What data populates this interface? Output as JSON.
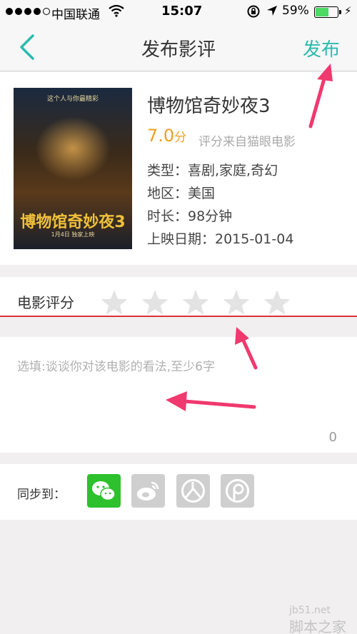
{
  "status": {
    "carrier": "中国联通",
    "time": "15:07",
    "battery_pct": "59%",
    "battery_level": 0.59,
    "signal_bars": 4
  },
  "nav": {
    "title": "发布影评",
    "publish_label": "发布"
  },
  "movie": {
    "title": "博物馆奇妙夜3",
    "rating_value": "7.0",
    "rating_unit": "分",
    "rating_source": "评分来自猫眼电影",
    "genre": "类型：喜剧,家庭,奇幻",
    "region": "地区：美国",
    "duration": "时长：98分钟",
    "release": "上映日期：2015-01-04",
    "poster": {
      "tagline": "这个人与你最精彩",
      "title": "博物馆奇妙夜3",
      "date": "1月4日 独家上映"
    }
  },
  "score": {
    "label": "电影评分",
    "stars": 5,
    "selected": 0
  },
  "comment": {
    "placeholder": "选填:谈谈你对该电影的看法,至少6字",
    "count": "0"
  },
  "sync": {
    "label": "同步到：",
    "targets": [
      "wechat-icon",
      "weibo-icon",
      "renren-icon",
      "qzone-icon"
    ]
  },
  "watermark": {
    "site": "jb51.net",
    "name": "脚本之家"
  },
  "colors": {
    "accent": "#2bbbad",
    "rating": "#f0a020",
    "arrow": "#f0396e",
    "divider": "#dd3333",
    "wechat": "#2dc12d"
  }
}
